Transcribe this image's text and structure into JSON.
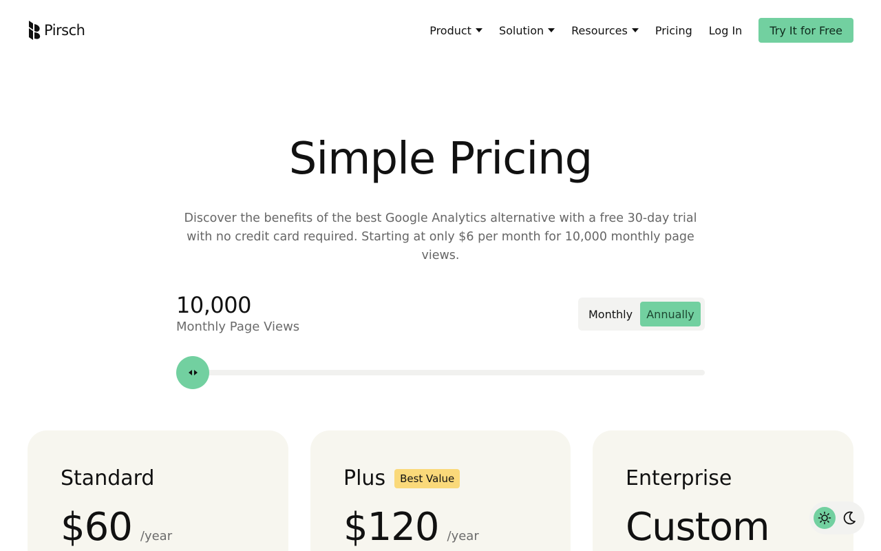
{
  "header": {
    "brand": "Pirsch",
    "nav": {
      "product": "Product",
      "solution": "Solution",
      "resources": "Resources",
      "pricing": "Pricing",
      "login": "Log In",
      "cta": "Try It for Free"
    }
  },
  "hero": {
    "title": "Simple Pricing",
    "subtitle": "Discover the benefits of the best Google Analytics alternative with a free 30-day trial with no credit card required. Starting at only $6 per month for 10,000 monthly page views."
  },
  "page_views": {
    "value": "10,000",
    "label": "Monthly Page Views",
    "slider_position": 0
  },
  "billing_toggle": {
    "monthly": "Monthly",
    "annually": "Annually",
    "selected": "annually"
  },
  "plans": [
    {
      "name": "Standard",
      "price": "$60",
      "period": "/year"
    },
    {
      "name": "Plus",
      "badge": "Best Value",
      "price": "$120",
      "period": "/year"
    },
    {
      "name": "Enterprise",
      "price": "Custom"
    }
  ],
  "theme_switch": {
    "light_icon": "sun-icon",
    "dark_icon": "moon-icon",
    "selected": "light"
  },
  "colors": {
    "accent": "#72d0a0",
    "card_bg": "#f7f6ef",
    "badge_bg": "#fad97a",
    "muted_text": "#666666"
  }
}
